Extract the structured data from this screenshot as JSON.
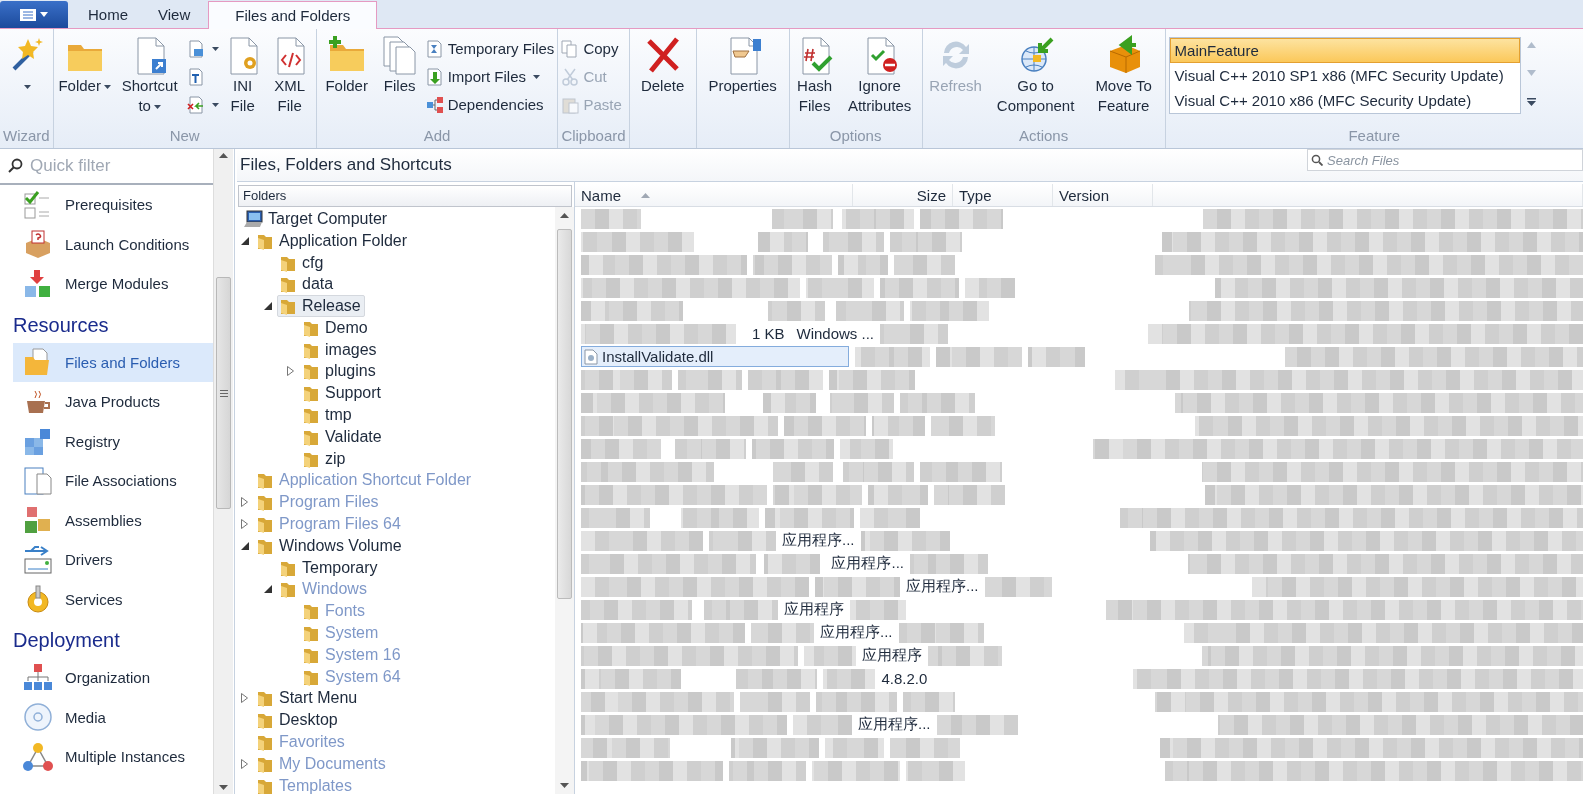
{
  "ribbon": {
    "tabs": [
      {
        "label": "Home",
        "selected": false
      },
      {
        "label": "View",
        "selected": false
      },
      {
        "label": "Files and Folders",
        "selected": true
      }
    ],
    "groups": [
      {
        "label": "Wizard",
        "items": [
          {
            "kind": "large",
            "dropdown": true,
            "disabled": false
          }
        ]
      },
      {
        "label": "New",
        "items": [
          {
            "kind": "large",
            "label": "Folder",
            "dropdown": true,
            "disabled": false
          },
          {
            "kind": "large",
            "label": "Shortcut to",
            "dropdown": true,
            "disabled": false
          },
          {
            "kind": "small",
            "dropdown": true,
            "disabled": false
          },
          {
            "kind": "small",
            "dropdown": false,
            "disabled": false
          },
          {
            "kind": "small",
            "dropdown": true,
            "disabled": false
          },
          {
            "kind": "large",
            "label": "INI File",
            "dropdown": false,
            "disabled": false
          },
          {
            "kind": "large",
            "label": "XML File",
            "dropdown": false,
            "disabled": false
          }
        ]
      },
      {
        "label": "Add",
        "items": [
          {
            "kind": "large",
            "label": "Folder",
            "dropdown": false,
            "disabled": false
          },
          {
            "kind": "large",
            "label": "Files",
            "dropdown": false,
            "disabled": false
          },
          {
            "kind": "small",
            "label": "Temporary Files",
            "dropdown": false,
            "disabled": false
          },
          {
            "kind": "small",
            "label": "Import Files",
            "dropdown": true,
            "disabled": false
          },
          {
            "kind": "small",
            "label": "Dependencies",
            "dropdown": false,
            "disabled": false
          }
        ]
      },
      {
        "label": "Clipboard",
        "items": [
          {
            "kind": "small",
            "label": "Copy",
            "dropdown": false,
            "disabled": false
          },
          {
            "kind": "small",
            "label": "Cut",
            "dropdown": false,
            "disabled": true
          },
          {
            "kind": "small",
            "label": "Paste",
            "dropdown": false,
            "disabled": true
          }
        ]
      },
      {
        "items": [
          {
            "kind": "large",
            "label": "Delete",
            "dropdown": false,
            "disabled": false
          }
        ]
      },
      {
        "items": [
          {
            "kind": "large",
            "label": "Properties",
            "dropdown": false,
            "disabled": false
          }
        ]
      },
      {
        "label": "Options",
        "items": [
          {
            "kind": "large",
            "label": "Hash Files",
            "dropdown": false,
            "disabled": false
          },
          {
            "kind": "large",
            "label": "Ignore Attributes",
            "dropdown": false,
            "disabled": false
          }
        ]
      },
      {
        "label": "Actions",
        "items": [
          {
            "kind": "large",
            "label": "Refresh",
            "dropdown": false,
            "disabled": true
          },
          {
            "kind": "large",
            "label": "Go to Component",
            "dropdown": false,
            "disabled": false
          },
          {
            "kind": "large",
            "label": "Move To Feature",
            "dropdown": false,
            "disabled": false
          }
        ]
      },
      {
        "label": "Feature",
        "items": [
          {
            "kind": "list",
            "entries": [
              {
                "label": "MainFeature",
                "selected": true
              },
              {
                "label": "Visual C++ 2010 SP1 x86 (MFC Security Update)",
                "selected": false
              },
              {
                "label": "Visual C++ 2010 x86 (MFC Security Update)",
                "selected": false
              }
            ]
          }
        ]
      }
    ]
  },
  "sidebar": {
    "filter": {
      "placeholder": "Quick filter"
    },
    "sections": [
      {
        "items": [
          {
            "label": "Prerequisites",
            "selected": false
          },
          {
            "label": "Launch Conditions",
            "selected": false
          },
          {
            "label": "Merge Modules",
            "selected": false
          }
        ]
      },
      {
        "title": "Resources",
        "items": [
          {
            "label": "Files and Folders",
            "selected": true
          },
          {
            "label": "Java Products",
            "selected": false
          },
          {
            "label": "Registry",
            "selected": false
          },
          {
            "label": "File Associations",
            "selected": false
          },
          {
            "label": "Assemblies",
            "selected": false
          },
          {
            "label": "Drivers",
            "selected": false
          },
          {
            "label": "Services",
            "selected": false
          }
        ]
      },
      {
        "title": "Deployment",
        "items": [
          {
            "label": "Organization",
            "selected": false
          },
          {
            "label": "Media",
            "selected": false
          },
          {
            "label": "Multiple Instances",
            "selected": false
          }
        ]
      }
    ]
  },
  "panel": {
    "title": "Files, Folders and Shortcuts",
    "search": {
      "placeholder": "Search Files"
    }
  },
  "tree": {
    "header": "Folders",
    "nodes": [
      {
        "kind": "computer",
        "label": "Target Computer",
        "selected": false,
        "dimmed": false,
        "children": [
          {
            "kind": "folder",
            "label": "Application Folder",
            "expanded": true,
            "selected": false,
            "dimmed": false,
            "children": [
              {
                "kind": "folder",
                "label": "cfg",
                "selected": false,
                "dimmed": false
              },
              {
                "kind": "folder",
                "label": "data",
                "selected": false,
                "dimmed": false
              },
              {
                "kind": "folder",
                "label": "Release",
                "expanded": true,
                "selected": true,
                "dimmed": false,
                "children": [
                  {
                    "kind": "folder",
                    "label": "Demo",
                    "selected": false,
                    "dimmed": false
                  },
                  {
                    "kind": "folder",
                    "label": "images",
                    "selected": false,
                    "dimmed": false
                  },
                  {
                    "kind": "folder",
                    "label": "plugins",
                    "expanded": false,
                    "selected": false,
                    "dimmed": false
                  },
                  {
                    "kind": "folder",
                    "label": "Support",
                    "selected": false,
                    "dimmed": false
                  },
                  {
                    "kind": "folder",
                    "label": "tmp",
                    "selected": false,
                    "dimmed": false
                  },
                  {
                    "kind": "folder",
                    "label": "Validate",
                    "selected": false,
                    "dimmed": false
                  },
                  {
                    "kind": "folder",
                    "label": "zip",
                    "selected": false,
                    "dimmed": false
                  }
                ]
              }
            ]
          },
          {
            "kind": "folder",
            "label": "Application Shortcut Folder",
            "selected": false,
            "dimmed": true
          },
          {
            "kind": "folder",
            "label": "Program Files",
            "expanded": false,
            "selected": false,
            "dimmed": true
          },
          {
            "kind": "folder",
            "label": "Program Files 64",
            "expanded": false,
            "selected": false,
            "dimmed": true
          },
          {
            "kind": "folder",
            "label": "Windows Volume",
            "expanded": true,
            "selected": false,
            "dimmed": false,
            "children": [
              {
                "kind": "folder",
                "label": "Temporary",
                "selected": false,
                "dimmed": false
              },
              {
                "kind": "folder",
                "label": "Windows",
                "expanded": true,
                "selected": false,
                "dimmed": true,
                "children": [
                  {
                    "kind": "folder",
                    "label": "Fonts",
                    "selected": false,
                    "dimmed": true
                  },
                  {
                    "kind": "folder",
                    "label": "System",
                    "selected": false,
                    "dimmed": true
                  },
                  {
                    "kind": "folder",
                    "label": "System 16",
                    "selected": false,
                    "dimmed": true
                  },
                  {
                    "kind": "folder",
                    "label": "System 64",
                    "selected": false,
                    "dimmed": true
                  }
                ]
              }
            ]
          },
          {
            "kind": "folder",
            "label": "Start Menu",
            "expanded": false,
            "selected": false,
            "dimmed": false
          },
          {
            "kind": "folder",
            "label": "Desktop",
            "selected": false,
            "dimmed": false
          },
          {
            "kind": "folder",
            "label": "Favorites",
            "selected": false,
            "dimmed": true
          },
          {
            "kind": "folder",
            "label": "My Documents",
            "expanded": false,
            "selected": false,
            "dimmed": true
          },
          {
            "kind": "folder",
            "label": "Templates",
            "selected": false,
            "dimmed": true
          }
        ]
      }
    ]
  },
  "files": {
    "columns": [
      {
        "label": "Name",
        "sorted": true
      },
      {
        "label": "Size",
        "sorted": false
      },
      {
        "label": "Type",
        "sorted": false
      },
      {
        "label": "Version",
        "sorted": false
      }
    ],
    "rows": [
      {
        "selected": false
      },
      {
        "selected": false
      },
      {
        "selected": false
      },
      {
        "selected": false
      },
      {
        "selected": false
      },
      {
        "size": "1 KB",
        "type": "Windows ...",
        "selected": false
      },
      {
        "name": "InstallValidate.dll",
        "selected": true
      },
      {
        "selected": false
      },
      {
        "selected": false
      },
      {
        "selected": false
      },
      {
        "selected": false
      },
      {
        "selected": false
      },
      {
        "selected": false
      },
      {
        "selected": false
      },
      {
        "type": "应用程序...",
        "selected": false
      },
      {
        "type": "应用程序...",
        "selected": false
      },
      {
        "type": "应用程序...",
        "selected": false
      },
      {
        "type": "应用程序",
        "selected": false
      },
      {
        "type": "应用程序...",
        "selected": false
      },
      {
        "type": "应用程序",
        "selected": false
      },
      {
        "version": "4.8.2.0",
        "selected": false
      },
      {
        "selected": false
      },
      {
        "type": "应用程序...",
        "selected": false
      },
      {
        "selected": false
      },
      {
        "selected": false
      }
    ]
  }
}
